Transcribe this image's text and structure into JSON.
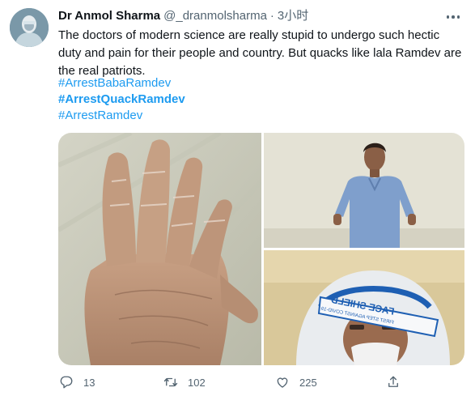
{
  "tweet": {
    "display_name": "Dr Anmol Sharma",
    "handle": "@_dranmolsharma",
    "separator": "·",
    "time": "3小时",
    "text": "The doctors of modern science are really stupid to undergo such hectic duty and pain for their people and country. But quacks like lala Ramdev are the real patriots.",
    "hashtags": [
      "#ArrestBabaRamdev",
      "#ArrestQuackRamdev",
      "#ArrestRamdev"
    ],
    "bold_hashtag_index": 1
  },
  "media": {
    "face_shield_text_line1": "FACE SHIELD",
    "face_shield_text_line2": "FIRST STEP AGAINST COVID-19"
  },
  "actions": {
    "reply_count": "13",
    "retweet_count": "102",
    "like_count": "225"
  },
  "colors": {
    "link": "#1d9bf0",
    "text": "#0f1419",
    "muted": "#536471"
  },
  "icons": [
    "more-icon",
    "reply-icon",
    "retweet-icon",
    "like-icon",
    "share-icon"
  ]
}
